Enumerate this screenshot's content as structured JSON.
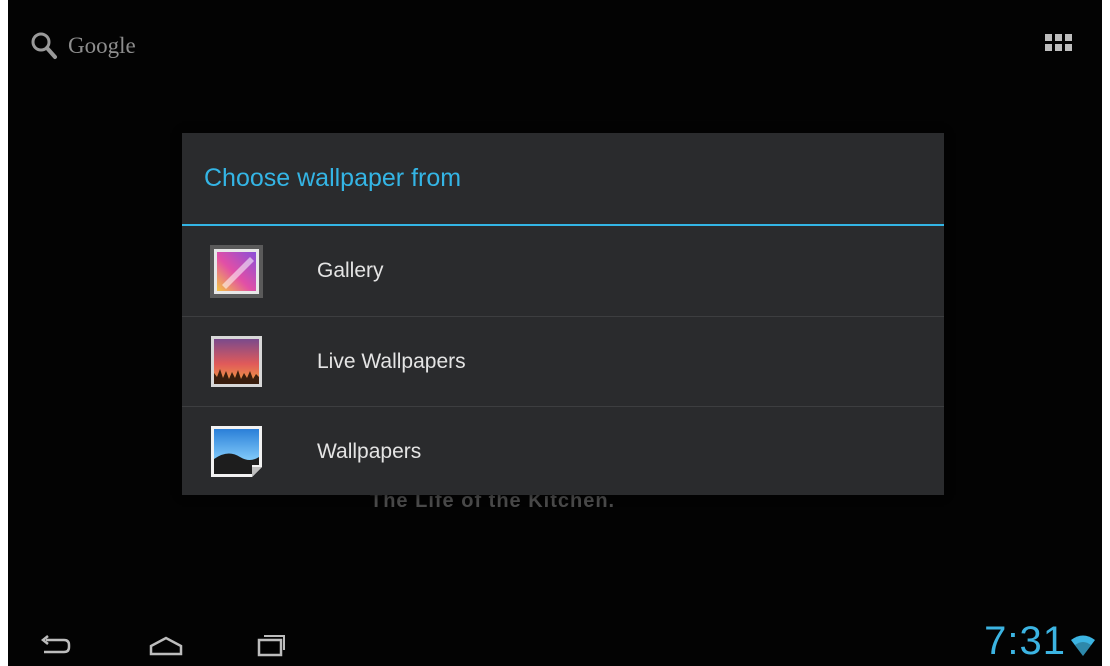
{
  "top_bar": {
    "search_label": "Google"
  },
  "home_screen": {
    "behind_text": "The Life of the Kitchen."
  },
  "dialog": {
    "title": "Choose wallpaper from",
    "options": [
      {
        "label": "Gallery",
        "icon": "gallery-icon"
      },
      {
        "label": "Live Wallpapers",
        "icon": "live-wallpapers-icon"
      },
      {
        "label": "Wallpapers",
        "icon": "wallpapers-icon"
      }
    ]
  },
  "status_bar": {
    "time": "7:31",
    "wifi": "wifi-icon"
  },
  "colors": {
    "accent": "#33b5e5",
    "dialog_bg": "#2a2b2d",
    "screen_bg": "#030303"
  }
}
